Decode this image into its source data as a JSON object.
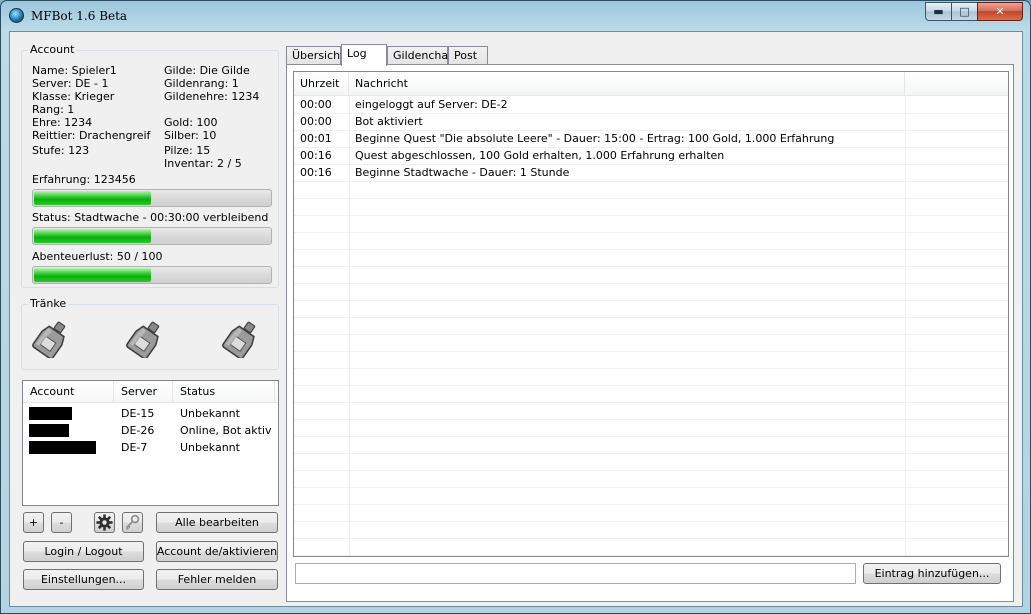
{
  "window": {
    "title": "MFBot 1.6 Beta",
    "controls": {
      "minimize": "▬",
      "maximize": "□",
      "close": "✕"
    }
  },
  "account": {
    "group_title": "Account",
    "left": [
      "Name: Spieler1",
      "Server: DE - 1",
      "Klasse: Krieger",
      "Rang: 1",
      "Ehre: 1234",
      "Reittier: Drachengreif",
      "Stufe: 123"
    ],
    "right_top": [
      "Gilde: Die Gilde",
      "Gildenrang: 1",
      "Gildenehre: 1234"
    ],
    "right_bottom": [
      "Gold: 100",
      "Silber: 10",
      "Pilze: 15",
      "Inventar: 2 / 5"
    ],
    "bars": [
      {
        "label": "Erfahrung: 123456",
        "fill": 0.5
      },
      {
        "label": "Status: Stadtwache - 00:30:00 verbleibend",
        "fill": 0.5
      },
      {
        "label": "Abenteuerlust: 50 / 100",
        "fill": 0.5
      }
    ]
  },
  "potions": {
    "group_title": "Tränke",
    "icons": [
      "potion-icon",
      "potion-icon",
      "potion-icon"
    ]
  },
  "accounts_list": {
    "columns": [
      "Account",
      "Server",
      "Status"
    ],
    "rows": [
      {
        "server": "DE-15",
        "status": "Unbekannt"
      },
      {
        "server": "DE-26",
        "status": "Online, Bot aktiv"
      },
      {
        "server": "DE-7",
        "status": "Unbekannt"
      }
    ]
  },
  "buttons": {
    "add": "+",
    "remove": "-",
    "settings_icon": "gear-icon",
    "key_icon": "key-icon",
    "edit_all": "Alle bearbeiten",
    "login_logout": "Login / Logout",
    "toggle_account": "Account de/aktivieren",
    "settings": "Einstellungen...",
    "report_error": "Fehler melden"
  },
  "tabs": [
    "Übersicht",
    "Log",
    "Gildenchat",
    "Post"
  ],
  "log": {
    "columns": [
      "Uhrzeit",
      "Nachricht"
    ],
    "rows": [
      {
        "time": "00:00",
        "msg": "eingeloggt auf Server: DE-2"
      },
      {
        "time": "00:00",
        "msg": "Bot aktiviert"
      },
      {
        "time": "00:01",
        "msg": "Beginne Quest \"Die absolute Leere\" - Dauer: 15:00 - Ertrag: 100 Gold, 1.000 Erfahrung"
      },
      {
        "time": "00:16",
        "msg": "Quest abgeschlossen, 100 Gold erhalten, 1.000 Erfahrung erhalten"
      },
      {
        "time": "00:16",
        "msg": "Beginne Stadtwache - Dauer: 1 Stunde"
      }
    ],
    "entry_value": "",
    "add_entry_button": "Eintrag hinzufügen..."
  }
}
